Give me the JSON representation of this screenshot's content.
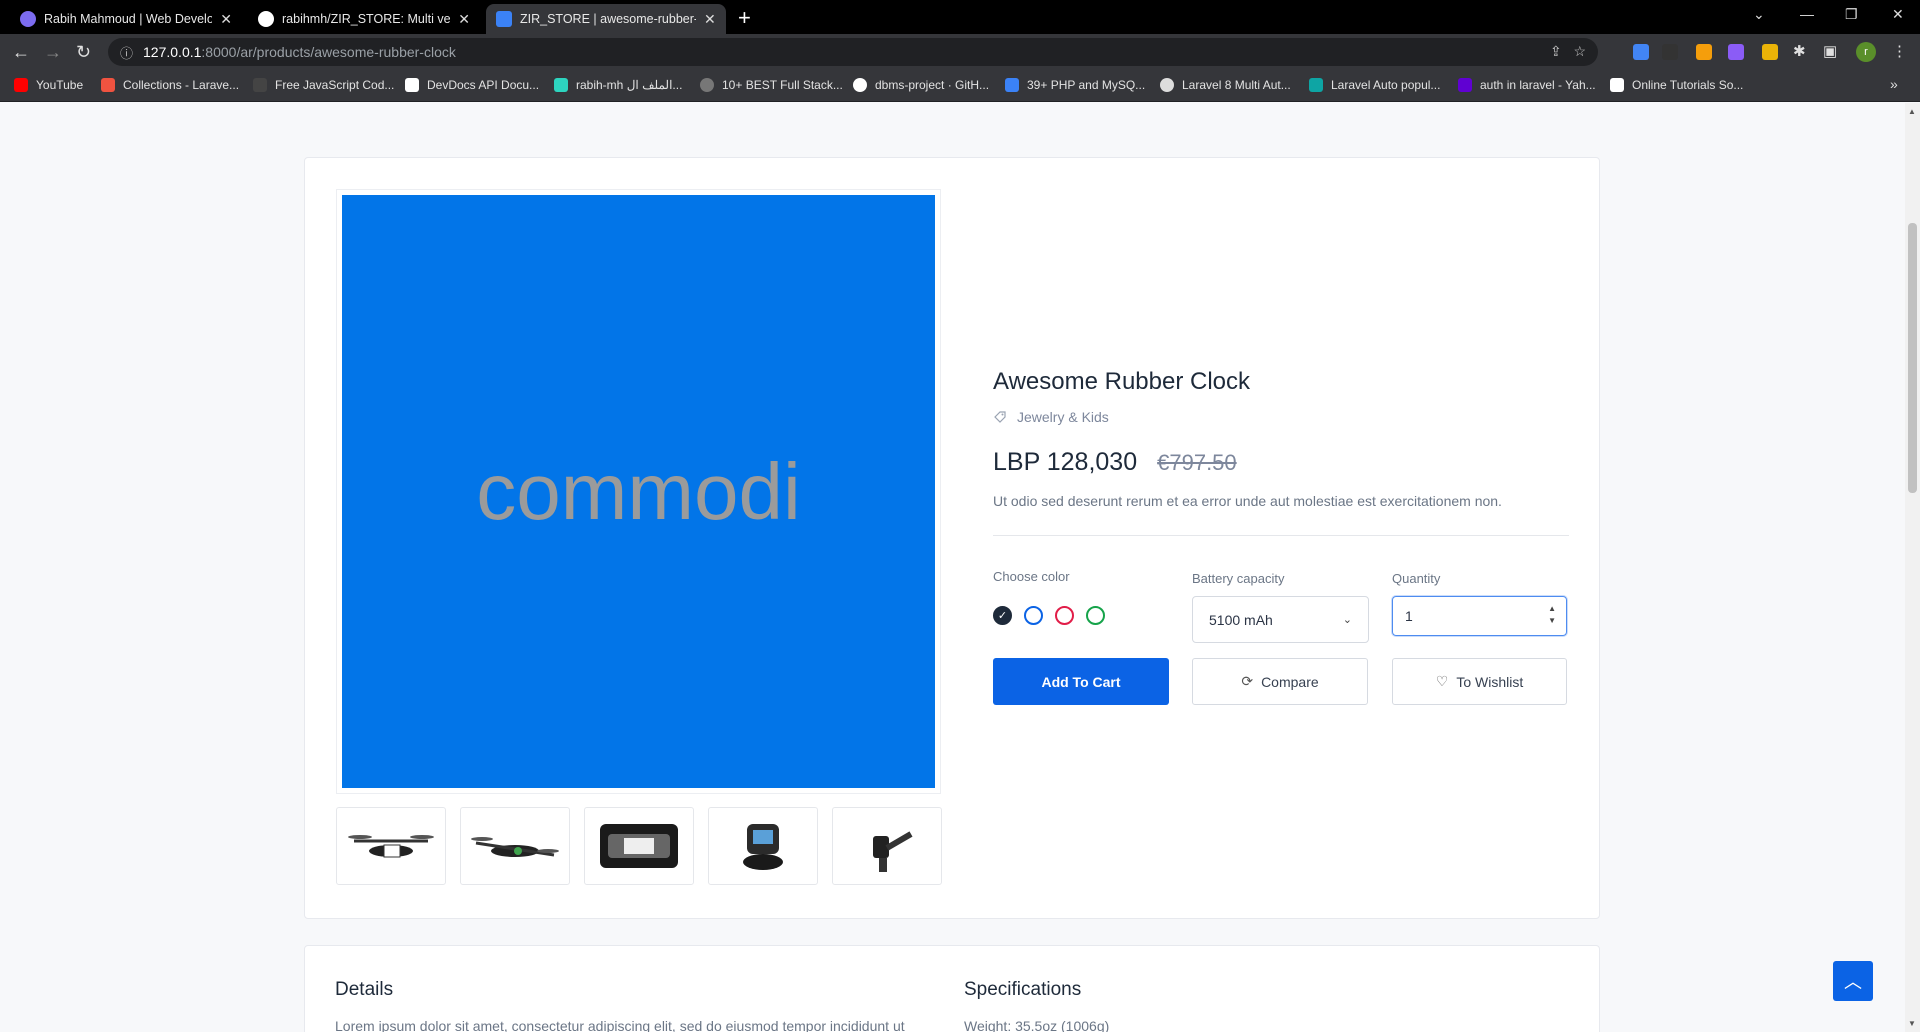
{
  "browser": {
    "tabs": [
      {
        "title": "Rabih Mahmoud | Web Develope",
        "color": "#7c6cf0"
      },
      {
        "title": "rabihmh/ZIR_STORE: Multi vendo",
        "color": "#ffffff"
      },
      {
        "title": "ZIR_STORE | awesome-rubber-clo",
        "color": "#3b82f6"
      }
    ],
    "url_host": "127.0.0.1",
    "url_path": ":8000/ar/products/awesome-rubber-clock",
    "profile_initial": "r",
    "bookmarks": [
      {
        "label": "YouTube",
        "color": "#ff0000"
      },
      {
        "label": "Collections - Larave...",
        "color": "#f05340"
      },
      {
        "label": "Free JavaScript Cod...",
        "color": "#444444"
      },
      {
        "label": "DevDocs API Docu...",
        "color": "#ffffff"
      },
      {
        "label": "rabih-mh الملف ال...",
        "color": "#2dd4bf"
      },
      {
        "label": "10+ BEST Full Stack...",
        "color": "#777777"
      },
      {
        "label": "dbms-project · GitH...",
        "color": "#ffffff"
      },
      {
        "label": "39+ PHP and MySQ...",
        "color": "#3b82f6"
      },
      {
        "label": "Laravel 8 Multi Aut...",
        "color": "#dddddd"
      },
      {
        "label": "Laravel Auto popul...",
        "color": "#0ea5a4"
      },
      {
        "label": "auth in laravel - Yah...",
        "color": "#6001d2"
      },
      {
        "label": "Online Tutorials So...",
        "color": "#ffffff"
      }
    ]
  },
  "product": {
    "image_text": "commodi",
    "image_bg": "#0275e8",
    "title": "Awesome Rubber Clock",
    "category": "Jewelry & Kids",
    "price": "LBP 128,030",
    "old_price": "€797.50",
    "description": "Ut odio sed deserunt rerum et ea error unde aut molestiae est exercitationem non.",
    "color_label": "Choose color",
    "colors": [
      "#1e2a3a",
      "#0b63e5",
      "#e11d48",
      "#16a34a"
    ],
    "battery_label": "Battery capacity",
    "battery_value": "5100 mAh",
    "quantity_label": "Quantity",
    "quantity_value": "1",
    "add_to_cart": "Add To Cart",
    "compare": "Compare",
    "wishlist": "To Wishlist"
  },
  "details": {
    "details_heading": "Details",
    "details_text": "Lorem ipsum dolor sit amet, consectetur adipiscing elit, sed do eiusmod tempor incididunt ut",
    "spec_heading": "Specifications",
    "spec_text": "Weight: 35.5oz (1006g)"
  }
}
